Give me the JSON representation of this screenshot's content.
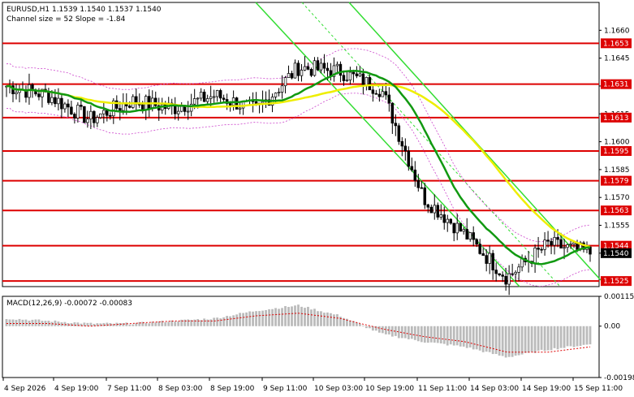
{
  "header": {
    "line1": "EURUSD,H1  1.1539 1.1540 1.1537 1.1540",
    "line2": "Channel size = 52 Slope = -1.84"
  },
  "macd_label": "MACD(12,26,9) -0.00072 -0.00083",
  "colors": {
    "up_candle": "#ffffff",
    "down_candle": "#000000",
    "level_line": "#dd0000",
    "ma_fast": "#119911",
    "ma_slow": "#eeee00",
    "channel": "#33dd33",
    "envelope": "#cc44cc",
    "macd_hist": "#bbbbbb",
    "macd_signal": "#dd0000"
  },
  "chart_data": {
    "type": "candlestick",
    "symbol": "EURUSD",
    "timeframe": "H1",
    "ylim": [
      1.1522,
      1.1675
    ],
    "price_ticks": [
      "1.1660",
      "1.1645",
      "1.1630",
      "1.1615",
      "1.1600",
      "1.1585",
      "1.1570",
      "1.1555",
      "1.1540"
    ],
    "level_labels": [
      "1.1653",
      "1.1631",
      "1.1613",
      "1.1595",
      "1.1579",
      "1.1563",
      "1.1544",
      "1.1525"
    ],
    "levels": [
      1.1653,
      1.1631,
      1.1613,
      1.1595,
      1.1579,
      1.1563,
      1.1544,
      1.1525
    ],
    "current_price": "1.1540",
    "time_labels": [
      "4 Sep 2026",
      "4 Sep 19:00",
      "7 Sep 11:00",
      "8 Sep 03:00",
      "8 Sep 19:00",
      "9 Sep 11:00",
      "10 Sep 03:00",
      "10 Sep 19:00",
      "11 Sep 11:00",
      "14 Sep 03:00",
      "14 Sep 19:00",
      "15 Sep 11:00"
    ],
    "close_anchors": [
      1.163,
      1.1625,
      1.1612,
      1.1622,
      1.1618,
      1.1625,
      1.1617,
      1.164,
      1.1638,
      1.1628,
      1.157,
      1.155,
      1.1527,
      1.1545,
      1.154
    ],
    "macd_ticks": [
      "0.00115",
      "0.00",
      "-0.00198"
    ],
    "macd_ylim": [
      -0.00198,
      0.00115
    ],
    "macd_hist_anchors": [
      0.0003,
      0.0002,
      0.0001,
      0.0001,
      0.0002,
      0.0003,
      0.0006,
      0.0008,
      0.0004,
      -0.0003,
      -0.0006,
      -0.0008,
      -0.0012,
      -0.0009,
      -0.0007
    ],
    "macd_signal_anchors": [
      0.0001,
      0.0001,
      0.0,
      0.0001,
      0.0002,
      0.0002,
      0.0004,
      0.0005,
      0.0003,
      -0.0001,
      -0.0004,
      -0.0006,
      -0.001,
      -0.001,
      -0.0008
    ]
  }
}
